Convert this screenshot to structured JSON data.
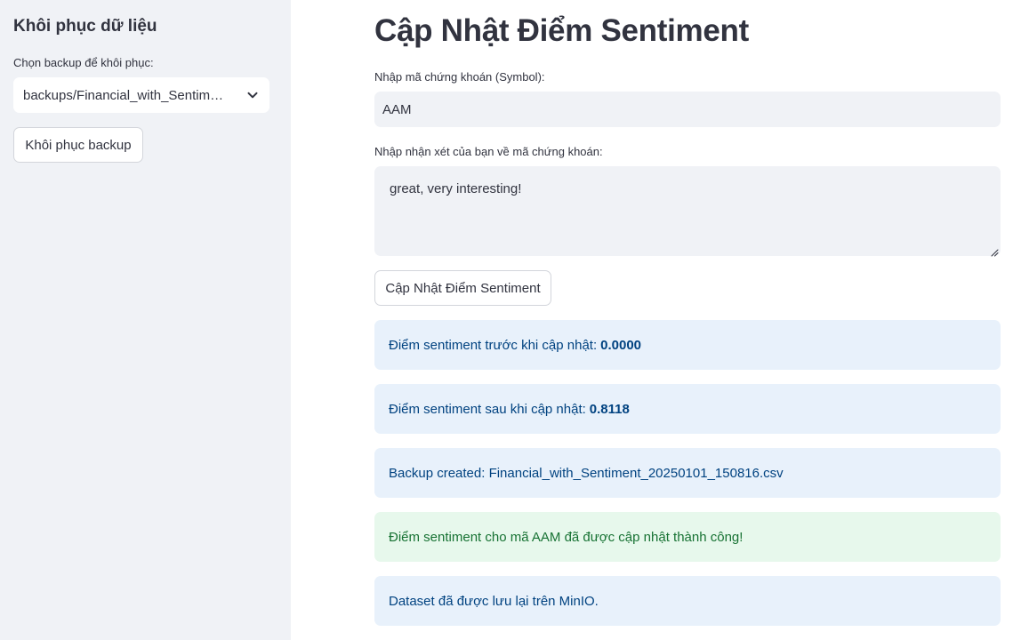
{
  "sidebar": {
    "title": "Khôi phục dữ liệu",
    "select_label": "Chọn backup để khôi phục:",
    "select_value": "backups/Financial_with_Sentim…",
    "restore_button": "Khôi phục backup"
  },
  "main": {
    "title": "Cập Nhật Điểm Sentiment",
    "symbol_label": "Nhập mã chứng khoán (Symbol):",
    "symbol_value": "AAM",
    "comment_label": "Nhập nhận xét của bạn về mã chứng khoán:",
    "comment_value": "great, very interesting!",
    "update_button": "Cập Nhật Điểm Sentiment"
  },
  "messages": {
    "before_label": "Điểm sentiment trước khi cập nhật:",
    "before_value": "0.0000",
    "after_label": "Điểm sentiment sau khi cập nhật:",
    "after_value": "0.8118",
    "backup_created": "Backup created: Financial_with_Sentiment_20250101_150816.csv",
    "success": "Điểm sentiment cho mã AAM đã được cập nhật thành công!",
    "saved": "Dataset đã được lưu lại trên MinIO."
  },
  "icons": {
    "select_chevron": "chevron-down-icon",
    "textarea_resize": "resize-handle-icon"
  },
  "colors": {
    "sidebar_bg": "#f0f2f6",
    "info_bg": "#e8f1fb",
    "info_text": "#004280",
    "success_bg": "#e7f8ec",
    "success_text": "#177233"
  }
}
